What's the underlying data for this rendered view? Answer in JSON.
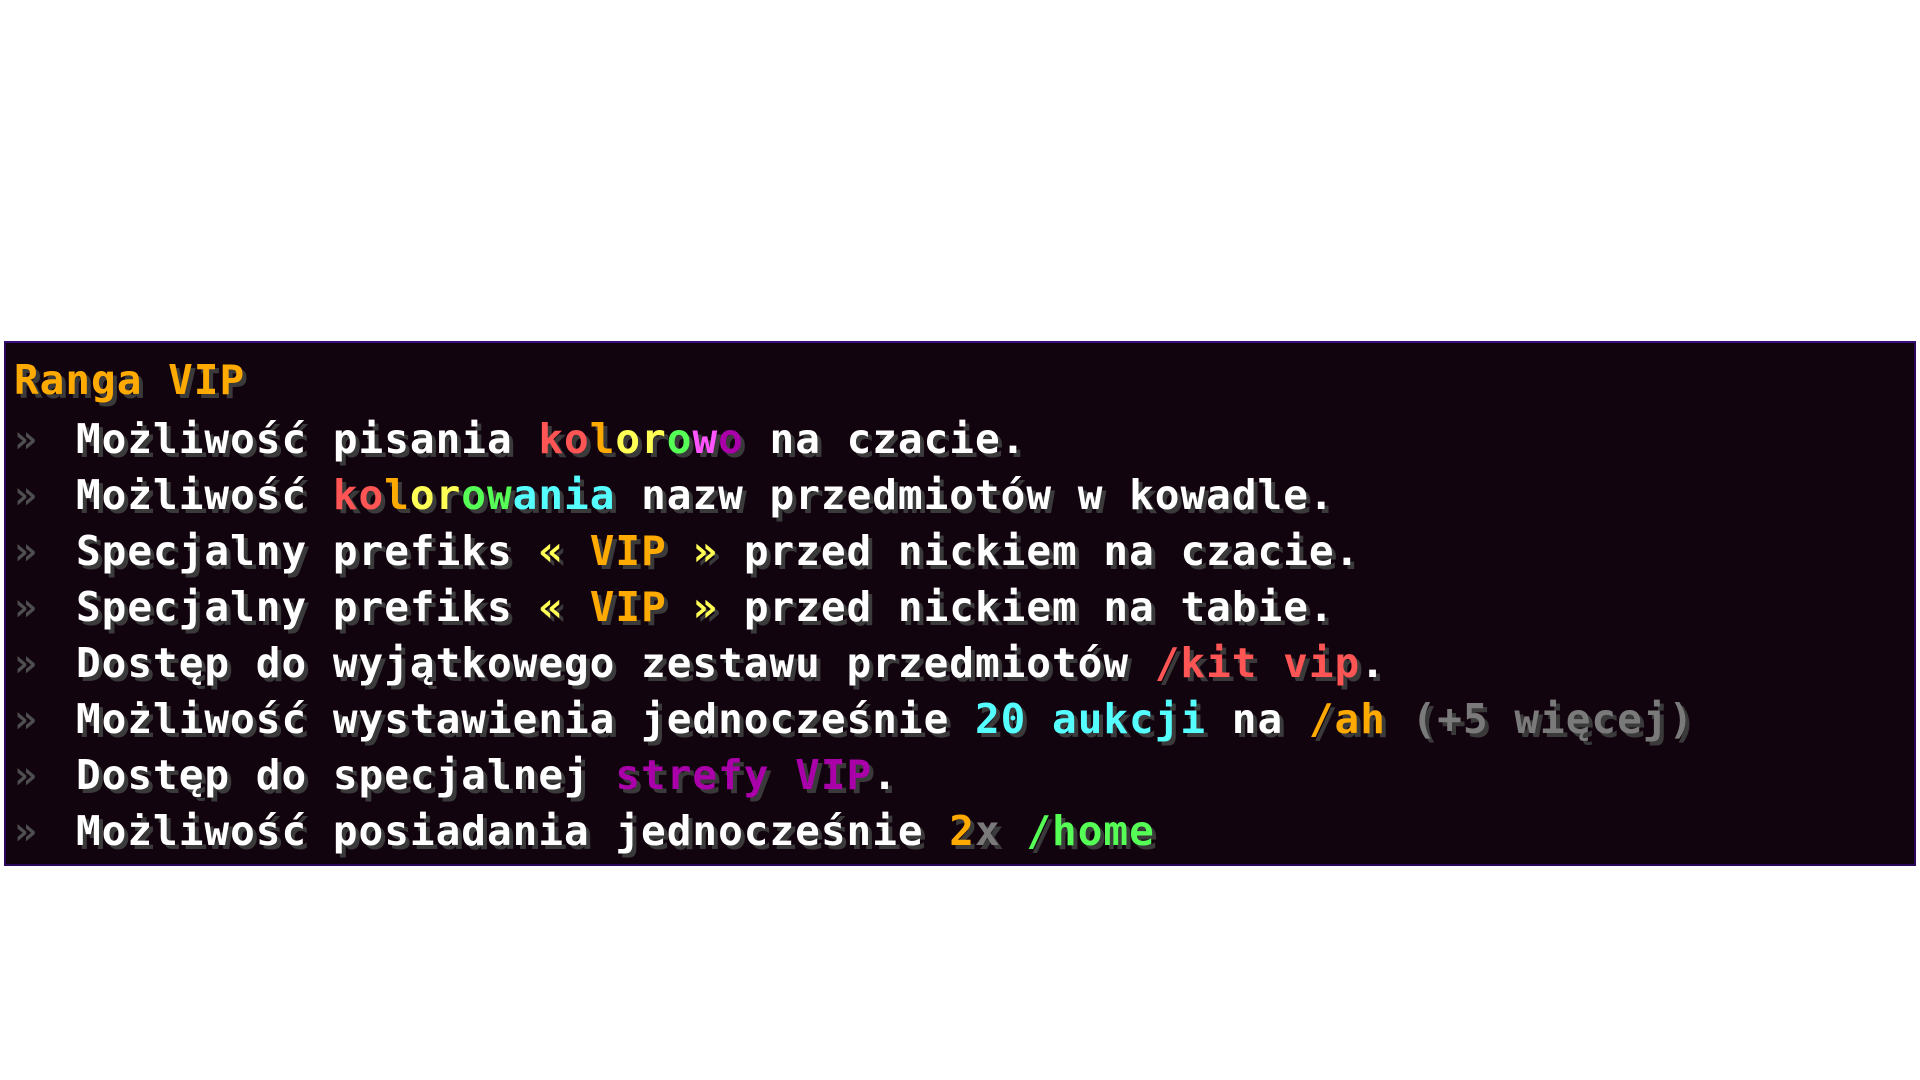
{
  "tooltip": {
    "title": {
      "text": "Ranga VIP",
      "color": "#ffaa00"
    },
    "bullet": "»",
    "lines": [
      {
        "segments": [
          {
            "t": "Możliwość pisania ",
            "c": "#ffffff"
          },
          {
            "t": "ko",
            "c": "#ff5555"
          },
          {
            "t": "l",
            "c": "#ffaa00"
          },
          {
            "t": "or",
            "c": "#ffff55"
          },
          {
            "t": "o",
            "c": "#55ff55"
          },
          {
            "t": "w",
            "c": "#ff55ff"
          },
          {
            "t": "o",
            "c": "#aa00aa"
          },
          {
            "t": " na czacie.",
            "c": "#ffffff"
          }
        ]
      },
      {
        "segments": [
          {
            "t": "Możliwość ",
            "c": "#ffffff"
          },
          {
            "t": "ko",
            "c": "#ff5555"
          },
          {
            "t": "l",
            "c": "#ffaa00"
          },
          {
            "t": "or",
            "c": "#ffff55"
          },
          {
            "t": "o",
            "c": "#55ff55"
          },
          {
            "t": "w",
            "c": "#55ff55"
          },
          {
            "t": "a",
            "c": "#55ffff"
          },
          {
            "t": "nia",
            "c": "#55ffff"
          },
          {
            "t": " nazw przedmiotów w kowadle.",
            "c": "#ffffff"
          }
        ]
      },
      {
        "segments": [
          {
            "t": "Specjalny prefiks ",
            "c": "#ffffff"
          },
          {
            "t": "« ",
            "c": "#ffff55"
          },
          {
            "t": "VIP",
            "c": "#ffaa00"
          },
          {
            "t": " »",
            "c": "#ffff55"
          },
          {
            "t": " przed nickiem na czacie.",
            "c": "#ffffff"
          }
        ]
      },
      {
        "segments": [
          {
            "t": "Specjalny prefiks ",
            "c": "#ffffff"
          },
          {
            "t": "« ",
            "c": "#ffff55"
          },
          {
            "t": "VIP",
            "c": "#ffaa00"
          },
          {
            "t": " »",
            "c": "#ffff55"
          },
          {
            "t": " przed nickiem na tabie.",
            "c": "#ffffff"
          }
        ]
      },
      {
        "segments": [
          {
            "t": "Dostęp do wyjątkowego zestawu przedmiotów ",
            "c": "#ffffff"
          },
          {
            "t": "/kit vip",
            "c": "#ff5555"
          },
          {
            "t": ".",
            "c": "#ffffff"
          }
        ]
      },
      {
        "segments": [
          {
            "t": "Możliwość wystawienia jednocześnie ",
            "c": "#ffffff"
          },
          {
            "t": "20 aukcji",
            "c": "#55ffff"
          },
          {
            "t": " na ",
            "c": "#ffffff"
          },
          {
            "t": "/ah",
            "c": "#ffaa00"
          },
          {
            "t": " (+5 więcej)",
            "c": "#7a7a7a"
          }
        ]
      },
      {
        "segments": [
          {
            "t": "Dostęp do specjalnej ",
            "c": "#ffffff"
          },
          {
            "t": "strefy VIP",
            "c": "#aa00aa"
          },
          {
            "t": ".",
            "c": "#ffffff"
          }
        ]
      },
      {
        "segments": [
          {
            "t": "Możliwość posiadania jednocześnie ",
            "c": "#ffffff"
          },
          {
            "t": "2",
            "c": "#ffaa00"
          },
          {
            "t": "x",
            "c": "#7a7a7a"
          },
          {
            "t": " ",
            "c": "#ffffff"
          },
          {
            "t": "/home",
            "c": "#55ff55"
          }
        ]
      }
    ]
  }
}
